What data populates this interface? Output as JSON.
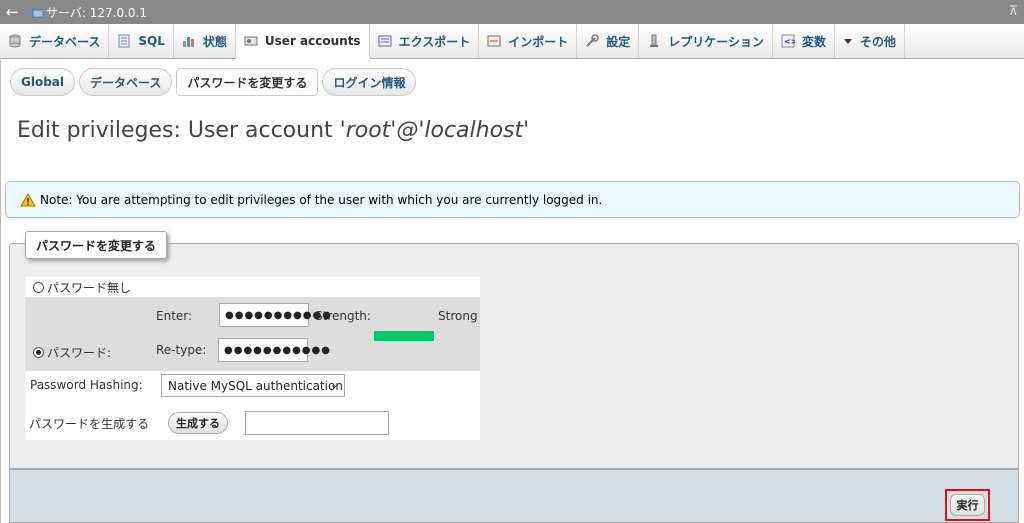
{
  "window": {
    "title": "サーバ: 127.0.0.1",
    "back_icon": "back-arrow-icon",
    "collapse_icon": "collapse-icon"
  },
  "tabs": [
    {
      "label": "データベース",
      "icon": "database-icon"
    },
    {
      "label": "SQL",
      "icon": "sql-icon"
    },
    {
      "label": "状態",
      "icon": "status-icon"
    },
    {
      "label": "User accounts",
      "icon": "users-icon",
      "active": true
    },
    {
      "label": "エクスポート",
      "icon": "export-icon"
    },
    {
      "label": "インポート",
      "icon": "import-icon"
    },
    {
      "label": "設定",
      "icon": "wrench-icon"
    },
    {
      "label": "レプリケーション",
      "icon": "replication-icon"
    },
    {
      "label": "変数",
      "icon": "variables-icon"
    },
    {
      "label": "その他",
      "icon": "triangle-down-icon"
    }
  ],
  "subtabs": [
    {
      "label": "Global"
    },
    {
      "label": "データベース"
    },
    {
      "label": "パスワードを変更する",
      "active": true
    },
    {
      "label": "ログイン情報"
    }
  ],
  "heading": {
    "prefix": "Edit privileges: User account ",
    "account": "'root'@'localhost'"
  },
  "notice": {
    "text": "Note: You are attempting to edit privileges of the user with which you are currently logged in."
  },
  "change_password": {
    "legend": "パスワードを変更する",
    "no_password_label": "パスワード無し",
    "password_label": "パスワード:",
    "enter_label": "Enter:",
    "enter_value": "●●●●●●●●●●●",
    "strength_label": "Strength:",
    "strength_text": "Strong",
    "strength_color": "#00cc66",
    "retype_label": "Re-type:",
    "retype_value": "●●●●●●●●●●●",
    "hashing_label": "Password Hashing:",
    "hashing_value": "Native MySQL authentication",
    "generate_label": "パスワードを生成する",
    "generate_button": "生成する",
    "generated_value": ""
  },
  "footer": {
    "go_button": "実行",
    "highlight_color": "#e01010"
  }
}
